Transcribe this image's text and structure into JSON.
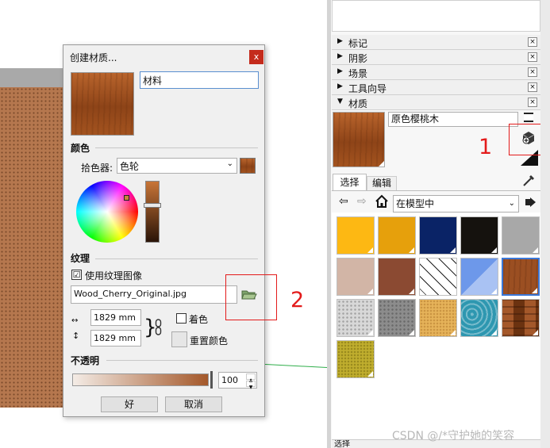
{
  "dialog": {
    "title": "创建材质...",
    "close_label": "x",
    "material_name": "材料",
    "color_section": "颜色",
    "picker_label": "拾色器:",
    "picker_value": "色轮",
    "texture_section": "纹理",
    "use_texture_label": "使用纹理图像",
    "use_texture_checked": "☑",
    "texture_file": "Wood_Cherry_Original.jpg",
    "width_value": "1829 mm",
    "height_value": "1829 mm",
    "colorize_label": "着色",
    "reset_color_label": "重置颜色",
    "opacity_section": "不透明",
    "opacity_value": "100",
    "ok_label": "好",
    "cancel_label": "取消"
  },
  "annotations": {
    "label_1": "1",
    "label_2": "2",
    "color": "#e31b1b"
  },
  "tray": {
    "panels": [
      {
        "label": "标记",
        "arrow": "▶"
      },
      {
        "label": "阴影",
        "arrow": "▶"
      },
      {
        "label": "场景",
        "arrow": "▶"
      },
      {
        "label": "工具向导",
        "arrow": "▶"
      },
      {
        "label": "材质",
        "arrow": "▼"
      }
    ],
    "close_glyph": "×",
    "material_name": "原色樱桃木",
    "tabs": [
      "选择",
      "编辑"
    ],
    "collection_value": "在模型中",
    "swatch_colors": [
      "#fdb813",
      "#e6a00c",
      "#0a2366",
      "#15120e",
      "#a8a8a8",
      "#d2b5a6",
      "#8b4a32",
      "#f2f2f2",
      "#6d98ea",
      "#9b4f22",
      "#d8d8d8",
      "#8c8c8c",
      "#e6b35a",
      "#2e97b0",
      "#7a3e17",
      "#c0ae2e"
    ],
    "bottom_label": "选择"
  },
  "watermark": "CSDN @/*守护她的笑容"
}
